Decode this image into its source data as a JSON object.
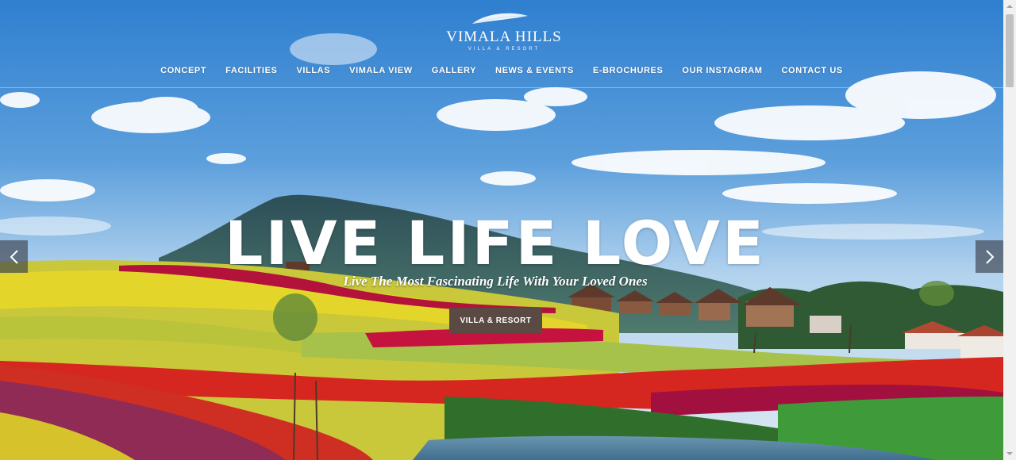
{
  "brand": {
    "name": "VIMALA HILLS",
    "tagline": "VILLA & RESORT"
  },
  "nav": {
    "items": [
      {
        "label": "CONCEPT"
      },
      {
        "label": "FACILITIES"
      },
      {
        "label": "VILLAS"
      },
      {
        "label": "VIMALA VIEW"
      },
      {
        "label": "GALLERY"
      },
      {
        "label": "NEWS & EVENTS"
      },
      {
        "label": "E-BROCHURES"
      },
      {
        "label": "OUR INSTAGRAM"
      },
      {
        "label": "CONTACT US"
      }
    ]
  },
  "hero": {
    "title": "LIVE LIFE LOVE",
    "subtitle": "Live The Most Fascinating Life With Your Loved Ones",
    "cta_label": "VILLA & RESORT"
  },
  "icons": {
    "prev": "chevron-left-icon",
    "next": "chevron-right-icon",
    "logo": "leaf-icon"
  },
  "colors": {
    "cta_background": "#5a4a43",
    "nav_text": "#ffffff",
    "arrow_background": "#3c414b"
  }
}
